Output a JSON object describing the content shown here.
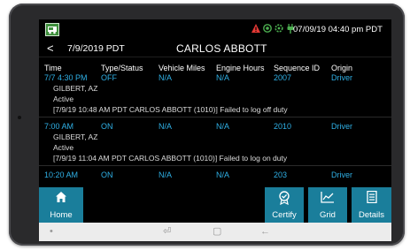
{
  "status_bar": {
    "datetime": "07/09/19 04:40 pm PDT",
    "icons": [
      "app-logo-icon",
      "warning-icon",
      "location-icon",
      "settings-icon",
      "plug-icon"
    ]
  },
  "header": {
    "back_label": "<",
    "date": "7/9/2019 PDT",
    "driver_name": "CARLOS ABBOTT"
  },
  "columns": [
    "Time",
    "Type/Status",
    "Vehicle Miles",
    "Engine Hours",
    "Sequence ID",
    "Origin"
  ],
  "rows": [
    {
      "time": "7/7 4:30 PM",
      "type": "OFF",
      "miles": "N/A",
      "hours": "N/A",
      "sequence": "2007",
      "origin": "Driver",
      "location": "GILBERT, AZ",
      "status": "Active",
      "note": "[7/9/19 10:48 AM PDT CARLOS ABBOTT (1010)] Failed to log off duty"
    },
    {
      "time": "7:00 AM",
      "type": "ON",
      "miles": "N/A",
      "hours": "N/A",
      "sequence": "2010",
      "origin": "Driver",
      "location": "GILBERT, AZ",
      "status": "Active",
      "note": "[7/9/19 11:04 AM PDT CARLOS ABBOTT (1010)] Failed to log on duty"
    },
    {
      "time": "10:20 AM",
      "type": "ON",
      "miles": "N/A",
      "hours": "N/A",
      "sequence": "203",
      "origin": "Driver"
    }
  ],
  "bottom_nav": {
    "home": "Home",
    "certify": "Certify",
    "grid": "Grid",
    "details": "Details"
  },
  "android_nav": {
    "dot": "•",
    "recent": "⏎",
    "home": "▢",
    "back": "←"
  },
  "colors": {
    "accent": "#1a7e9b",
    "value_text": "#2fb0e6",
    "warning": "#e53935",
    "location": "#4caf50"
  }
}
